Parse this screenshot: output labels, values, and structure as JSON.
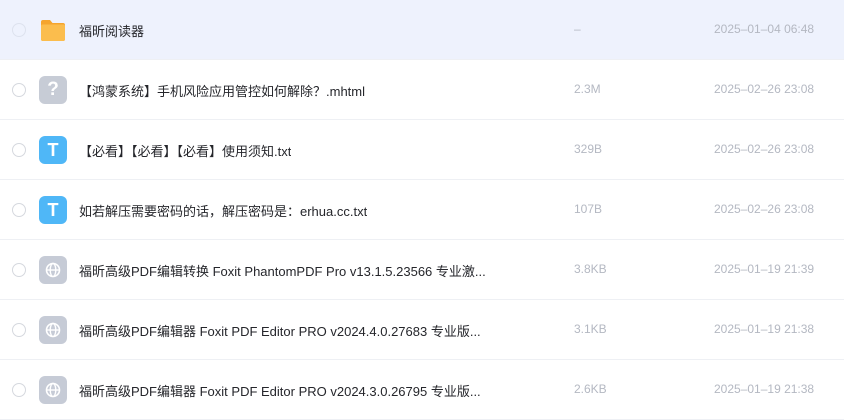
{
  "files": [
    {
      "name": "福昕阅读器",
      "size": "–",
      "date": "2025–01–04 06:48",
      "icon": "folder-icon",
      "selected": true
    },
    {
      "name": "【鸿蒙系统】手机风险应用管控如何解除？.mhtml",
      "size": "2.3M",
      "date": "2025–02–26 23:08",
      "icon": "unknown-file-icon",
      "selected": false
    },
    {
      "name": "【必看】【必看】【必看】使用须知.txt",
      "size": "329B",
      "date": "2025–02–26 23:08",
      "icon": "text-file-icon",
      "selected": false
    },
    {
      "name": "如若解压需要密码的话，解压密码是：erhua.cc.txt",
      "size": "107B",
      "date": "2025–02–26 23:08",
      "icon": "text-file-icon",
      "selected": false
    },
    {
      "name": "福昕高级PDF编辑转换 Foxit PhantomPDF Pro v13.1.5.23566 专业激...",
      "size": "3.8KB",
      "date": "2025–01–19 21:39",
      "icon": "web-file-icon",
      "selected": false
    },
    {
      "name": "福昕高级PDF编辑器 Foxit PDF Editor PRO v2024.4.0.27683 专业版...",
      "size": "3.1KB",
      "date": "2025–01–19 21:38",
      "icon": "web-file-icon",
      "selected": false
    },
    {
      "name": "福昕高级PDF编辑器 Foxit PDF Editor PRO v2024.3.0.26795 专业版...",
      "size": "2.6KB",
      "date": "2025–01–19 21:38",
      "icon": "web-file-icon",
      "selected": false
    }
  ],
  "icon_glyphs": {
    "unknown": "?",
    "text": "T"
  },
  "colors": {
    "selected_row_bg": "#eef2fd",
    "folder": "#f7b43f",
    "text_icon": "#4fb7f7",
    "generic_icon": "#c6cbd6",
    "meta_text": "#b4b8c2"
  }
}
